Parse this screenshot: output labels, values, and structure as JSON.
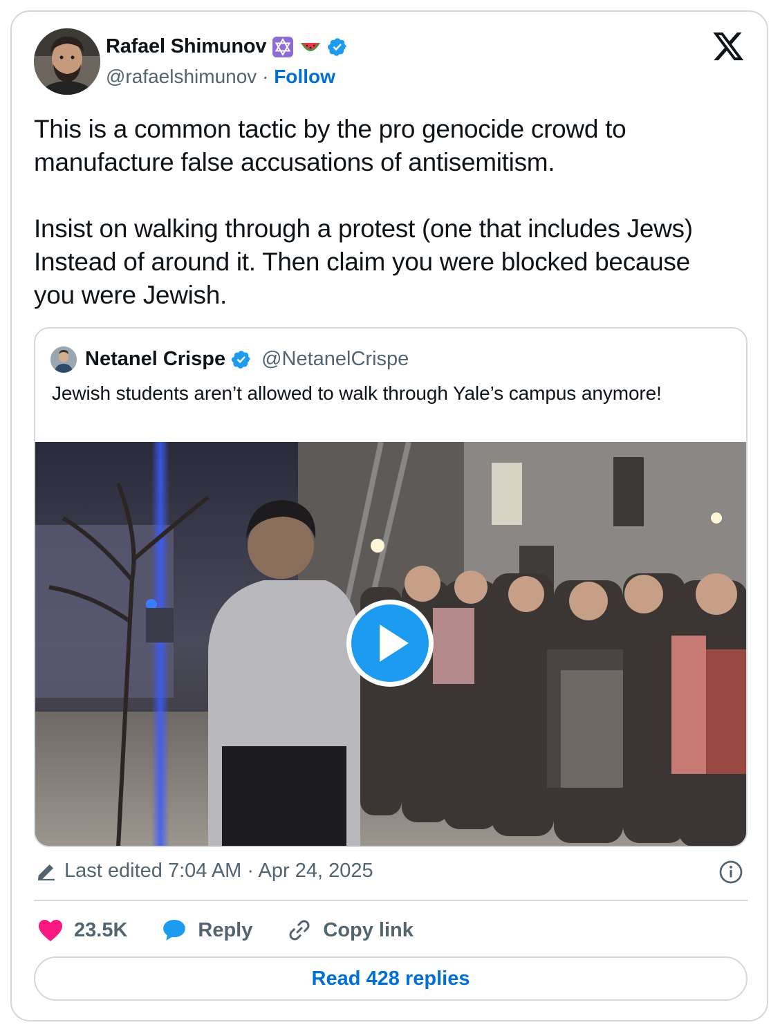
{
  "author": {
    "name": "Rafael Shimunov",
    "handle": "@rafaelshimunov",
    "separator": "·",
    "follow_label": "Follow",
    "badges": [
      "star-of-david-icon",
      "watermelon-icon",
      "verified-badge-icon"
    ]
  },
  "tweet": {
    "paragraphs": [
      "This is a common tactic by the pro genocide crowd to manufacture false accusations of antisemitism.",
      "Insist on walking through a protest (one that includes Jews) Instead of around it. Then claim you were blocked because you were Jewish."
    ]
  },
  "quote": {
    "name": "Netanel Crispe",
    "handle": "@NetanelCrispe",
    "text": "Jewish students aren’t allowed to walk through Yale’s campus anymore!",
    "media_type": "video"
  },
  "meta": {
    "edited_text": "Last edited 7:04 AM · Apr 24, 2025"
  },
  "actions": {
    "likes": "23.5K",
    "reply_label": "Reply",
    "copy_link_label": "Copy link"
  },
  "read_replies_label": "Read 428 replies",
  "colors": {
    "link": "#006fd6",
    "like": "#f91880",
    "reply": "#1d9bf0",
    "verified": "#1d9bf0",
    "border": "#cfd9de",
    "secondary_text": "#536471"
  }
}
